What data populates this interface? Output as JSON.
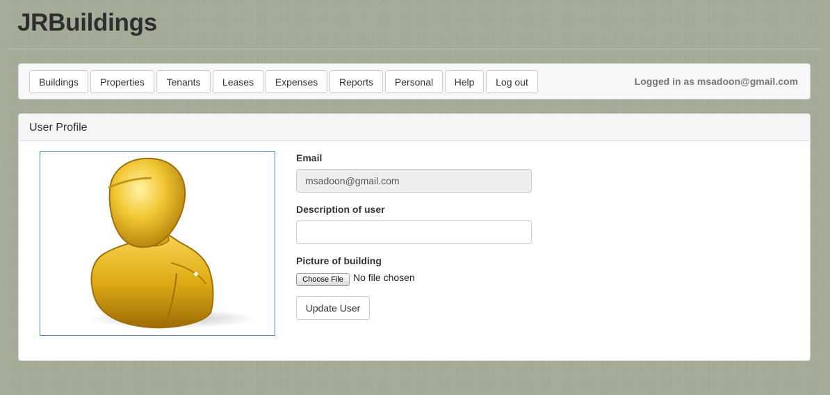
{
  "app": {
    "brand": "JRBuildings"
  },
  "nav": {
    "items": [
      {
        "label": "Buildings"
      },
      {
        "label": "Properties"
      },
      {
        "label": "Tenants"
      },
      {
        "label": "Leases"
      },
      {
        "label": "Expenses"
      },
      {
        "label": "Reports"
      },
      {
        "label": "Personal"
      },
      {
        "label": "Help"
      },
      {
        "label": "Log out"
      }
    ],
    "logged_in_text": "Logged in as msadoon@gmail.com"
  },
  "panel": {
    "title": "User Profile",
    "avatar_icon": "user-avatar-gold-bust"
  },
  "form": {
    "email_label": "Email",
    "email_value": "msadoon@gmail.com",
    "description_label": "Description of user",
    "description_value": "",
    "picture_label": "Picture of building",
    "choose_file_label": "Choose File",
    "file_status": "No file chosen",
    "submit_label": "Update User"
  },
  "colors": {
    "background": "#a4ab97",
    "avatar_gold": "#e8b923",
    "frame_border": "#428bca"
  }
}
